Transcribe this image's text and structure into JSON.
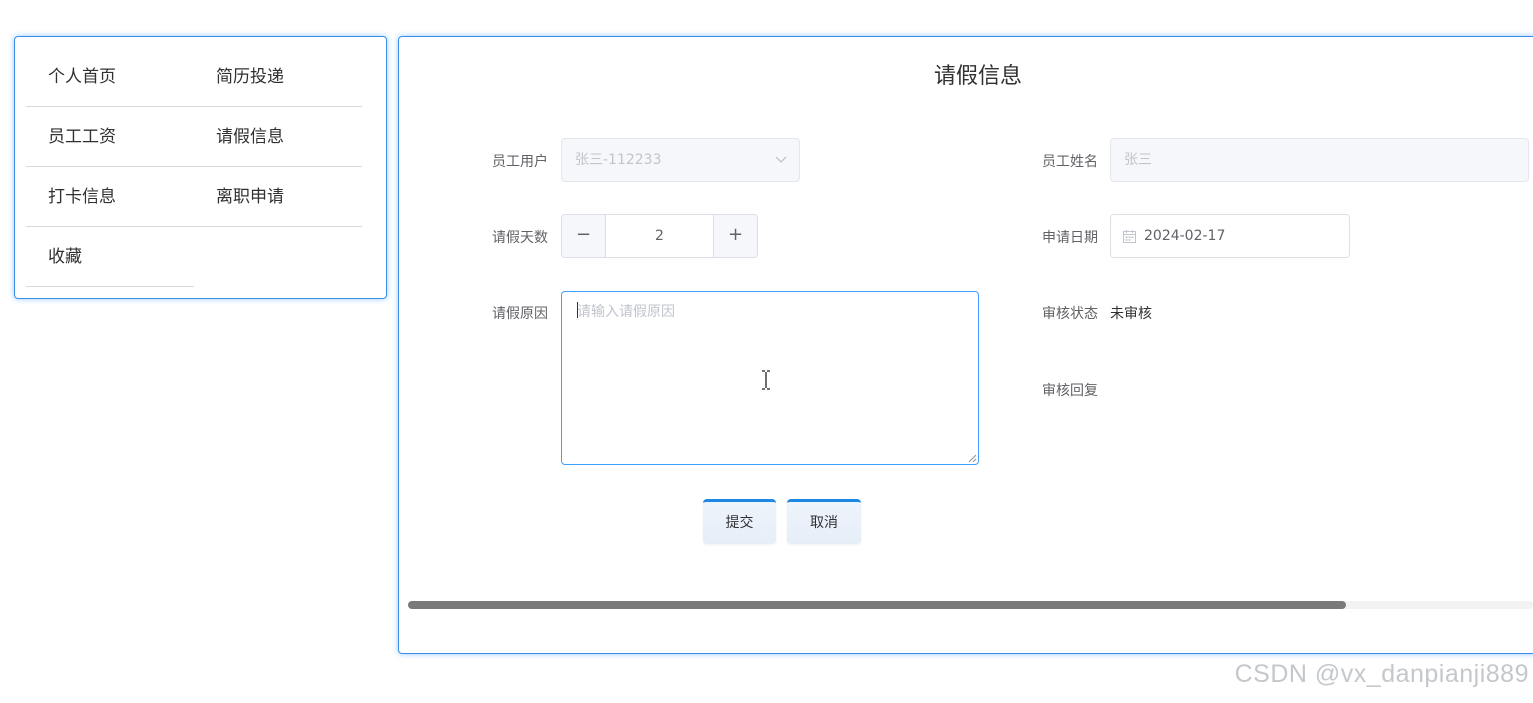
{
  "nav": {
    "items": [
      {
        "label": "个人首页"
      },
      {
        "label": "简历投递"
      },
      {
        "label": "员工工资"
      },
      {
        "label": "请假信息"
      },
      {
        "label": "打卡信息"
      },
      {
        "label": "离职申请"
      },
      {
        "label": "收藏"
      }
    ]
  },
  "form": {
    "title": "请假信息",
    "employee_user": {
      "label": "员工用户",
      "value": "张三-112233"
    },
    "employee_name": {
      "label": "员工姓名",
      "value": "张三"
    },
    "leave_days": {
      "label": "请假天数",
      "value": "2",
      "minus": "−",
      "plus": "+"
    },
    "apply_date": {
      "label": "申请日期",
      "value": "2024-02-17"
    },
    "leave_reason": {
      "label": "请假原因",
      "placeholder": "请输入请假原因"
    },
    "review_status": {
      "label": "审核状态",
      "value": "未审核"
    },
    "review_reply": {
      "label": "审核回复"
    },
    "submit_label": "提交",
    "cancel_label": "取消"
  },
  "scrollbar": {
    "position_fraction": 0.83
  },
  "watermark": "CSDN @vx_danpianji889"
}
